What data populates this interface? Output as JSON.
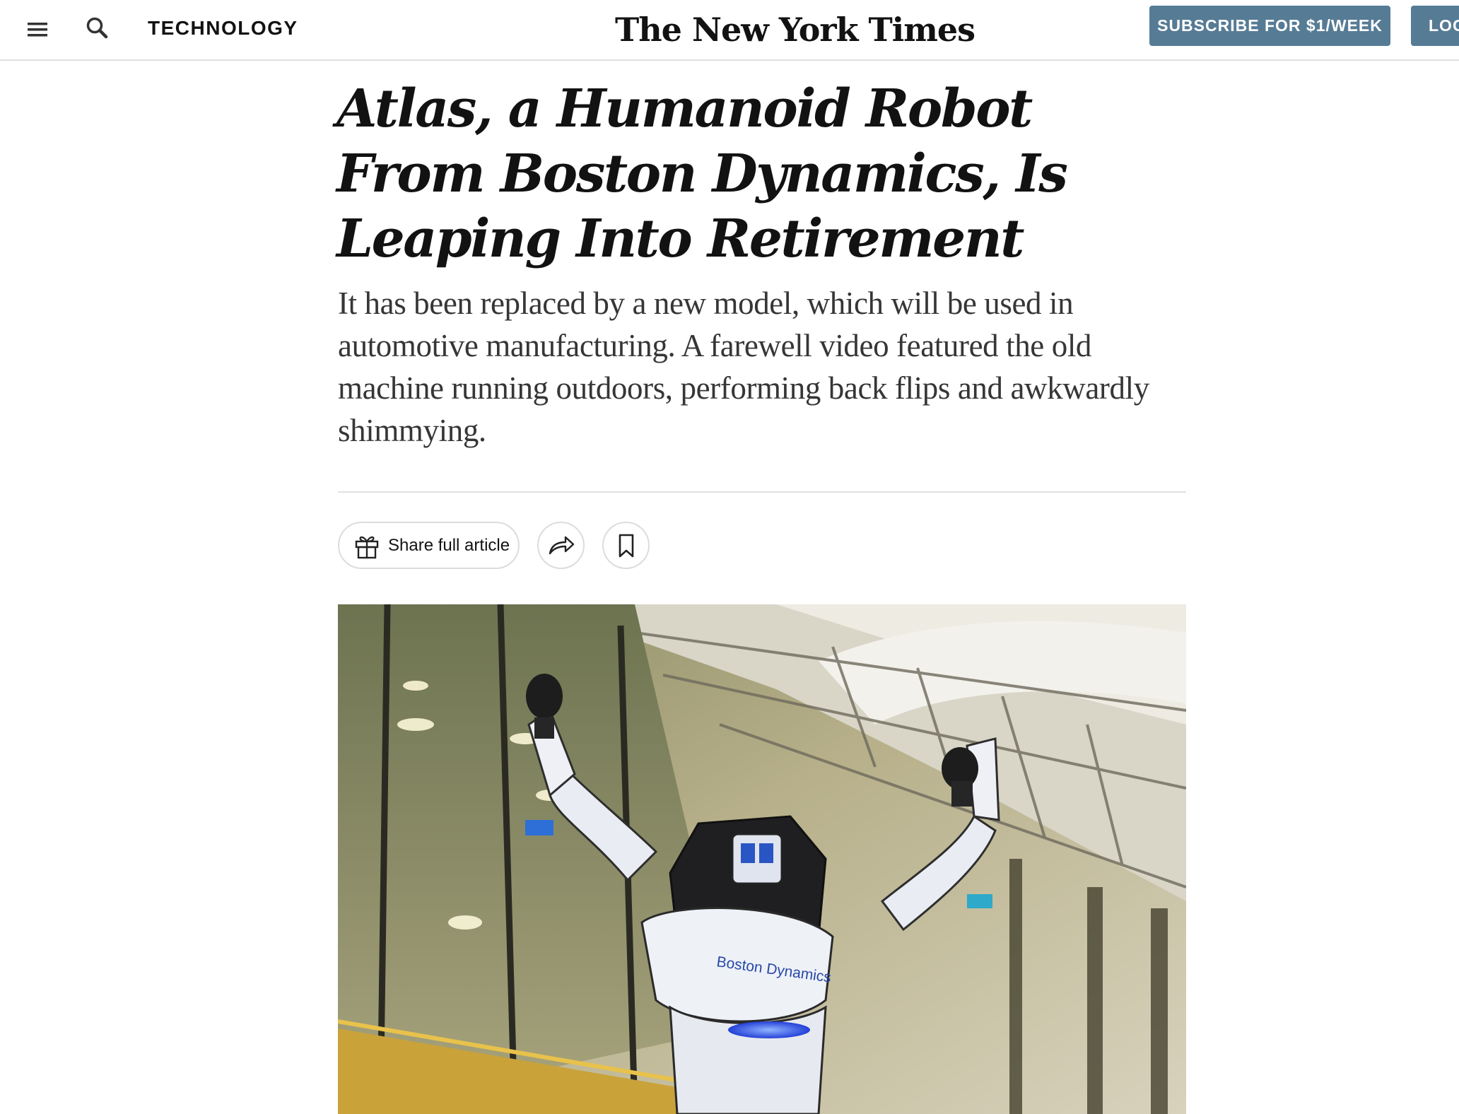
{
  "header": {
    "menu_icon": "hamburger-menu-icon",
    "search_icon": "search-icon",
    "section": "TECHNOLOGY",
    "masthead": "The New York Times",
    "subscribe_label": "SUBSCRIBE FOR $1/WEEK",
    "login_label": "LOG IN",
    "button_color": "#567b95"
  },
  "article": {
    "headline": "Atlas, a Humanoid Robot From Boston Dynamics, Is Leaping Into Retirement",
    "summary": "It has been replaced by a new model, which will be used in automotive manufacturing. A farewell video featured the old machine running outdoors, performing back flips and awkwardly shimmying.",
    "share_label": "Share full article",
    "share_icon": "gift-icon",
    "forward_icon": "share-arrow-icon",
    "save_icon": "bookmark-icon"
  },
  "photo": {
    "robot_chest_text": "Boston Dynamics"
  }
}
